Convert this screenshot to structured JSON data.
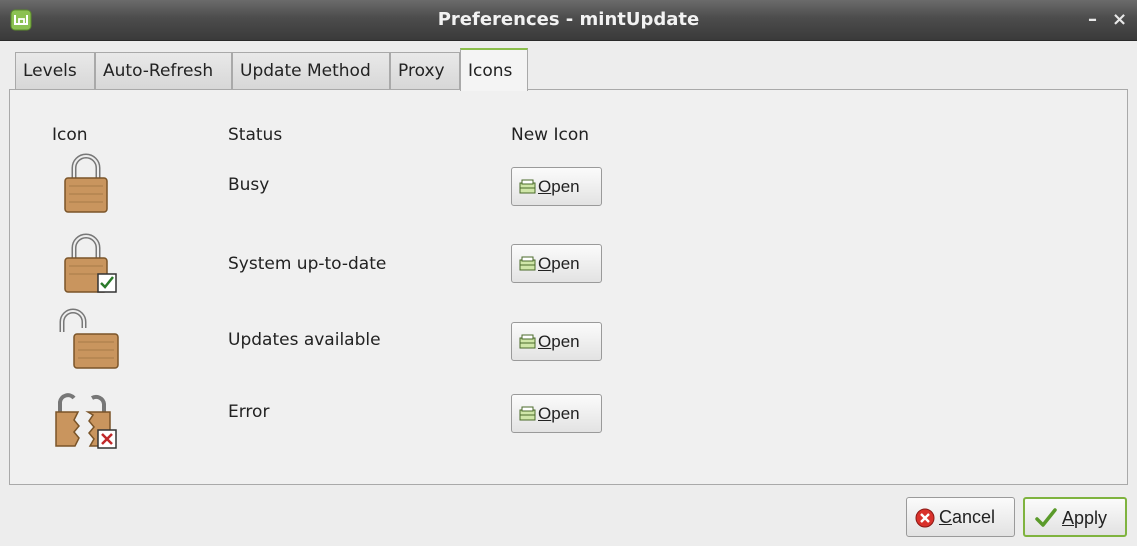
{
  "window": {
    "title": "Preferences - mintUpdate",
    "minimize_label": "–",
    "close_label": "×"
  },
  "tabs": [
    {
      "label": "Levels"
    },
    {
      "label": "Auto-Refresh"
    },
    {
      "label": "Update Method"
    },
    {
      "label": "Proxy"
    },
    {
      "label": "Icons",
      "active": true
    }
  ],
  "icons_panel": {
    "headers": {
      "icon": "Icon",
      "status": "Status",
      "new_icon": "New Icon"
    },
    "rows": [
      {
        "status": "Busy",
        "icon": "lock-closed-icon",
        "button": "Open"
      },
      {
        "status": "System up-to-date",
        "icon": "lock-checked-icon",
        "button": "Open"
      },
      {
        "status": "Updates available",
        "icon": "lock-open-icon",
        "button": "Open"
      },
      {
        "status": "Error",
        "icon": "lock-broken-icon",
        "button": "Open"
      }
    ]
  },
  "footer": {
    "cancel_label": "Cancel",
    "apply_label": "Apply"
  },
  "colors": {
    "accent": "#8cbf4c",
    "lock_body": "#c9955e",
    "titlebar": "#4c4c4c"
  }
}
